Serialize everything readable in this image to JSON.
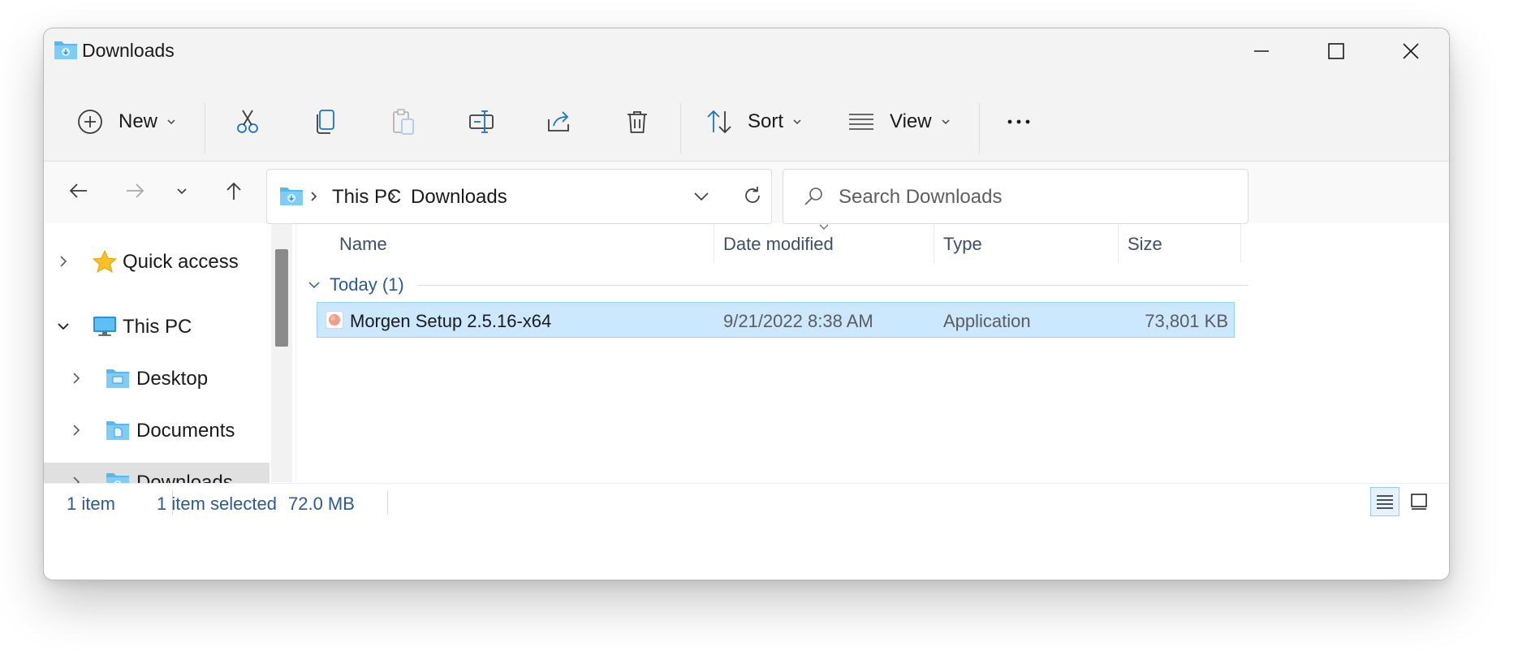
{
  "window": {
    "title": "Downloads"
  },
  "toolbar": {
    "new_label": "New",
    "sort_label": "Sort",
    "view_label": "View",
    "actions": [
      "cut",
      "copy",
      "paste",
      "rename",
      "share",
      "delete",
      "see-more"
    ]
  },
  "address": {
    "crumbs": [
      "This PC",
      "Downloads"
    ]
  },
  "search": {
    "placeholder": "Search Downloads"
  },
  "sidebar": {
    "items": [
      {
        "label": "Quick access",
        "icon": "star-icon",
        "expanded": false
      },
      {
        "label": "This PC",
        "icon": "monitor-icon",
        "expanded": true
      },
      {
        "label": "Desktop",
        "icon": "folder-desktop-icon",
        "expanded": false
      },
      {
        "label": "Documents",
        "icon": "folder-documents-icon",
        "expanded": false
      },
      {
        "label": "Downloads",
        "icon": "folder-downloads-icon",
        "expanded": false,
        "selected": true
      }
    ]
  },
  "columns": {
    "name": "Name",
    "date": "Date modified",
    "type": "Type",
    "size": "Size"
  },
  "group": {
    "label": "Today (1)"
  },
  "files": [
    {
      "name": "Morgen Setup 2.5.16-x64",
      "date": "9/21/2022 8:38 AM",
      "type": "Application",
      "size": "73,801 KB",
      "selected": true
    }
  ],
  "status": {
    "count": "1 item",
    "selected": "1 item selected",
    "size": "72.0 MB"
  },
  "colors": {
    "accent": "#0067c0",
    "selection_bg": "#cce8ff",
    "selection_border": "#99d1ff",
    "folder": "#55b8f0"
  }
}
